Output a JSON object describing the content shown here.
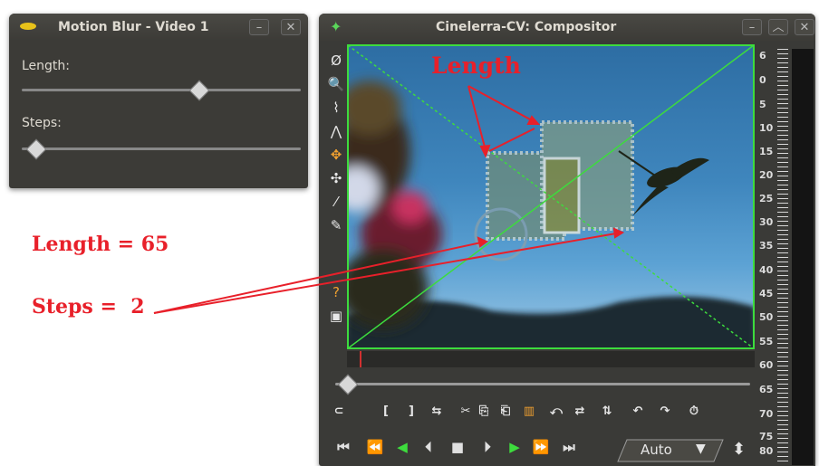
{
  "motion_blur": {
    "title": "Motion Blur - Video 1",
    "length_label": "Length:",
    "steps_label": "Steps:",
    "minimize": "–",
    "close": "✕"
  },
  "compositor": {
    "title": "Cinelerra-CV: Compositor",
    "minimize": "–",
    "maximize": "︿",
    "close": "✕",
    "tools": [
      "Ø",
      "🔍",
      "⌇",
      "⋀",
      "✥",
      "✣",
      "⁄",
      "✎",
      "?",
      "▣"
    ],
    "transport_tools": [
      "⊂",
      "[",
      "]",
      "⇆",
      "✂",
      "⎘",
      "⎗",
      "▥",
      "⤺",
      "⇄",
      "⇅",
      "↶",
      "↷",
      "⏱"
    ],
    "playback": [
      "⏮",
      "⏪",
      "◀",
      "⏴",
      "■",
      "⏵",
      "▶",
      "⏩",
      "⏭"
    ],
    "zoom_value": "Auto",
    "zoom_arrow": "▼",
    "spin": "⬍",
    "meter_ticks": [
      "6",
      "0",
      "5",
      "10",
      "15",
      "20",
      "25",
      "30",
      "35",
      "40",
      "45",
      "50",
      "55",
      "60",
      "65",
      "70",
      "75",
      "80"
    ]
  },
  "annotations": {
    "length_top": "Length",
    "length_eq": "Length = 65",
    "steps_eq": "Steps =  2"
  },
  "colors": {
    "annotation": "#e8202a",
    "accent_green": "#3ddc3d"
  }
}
